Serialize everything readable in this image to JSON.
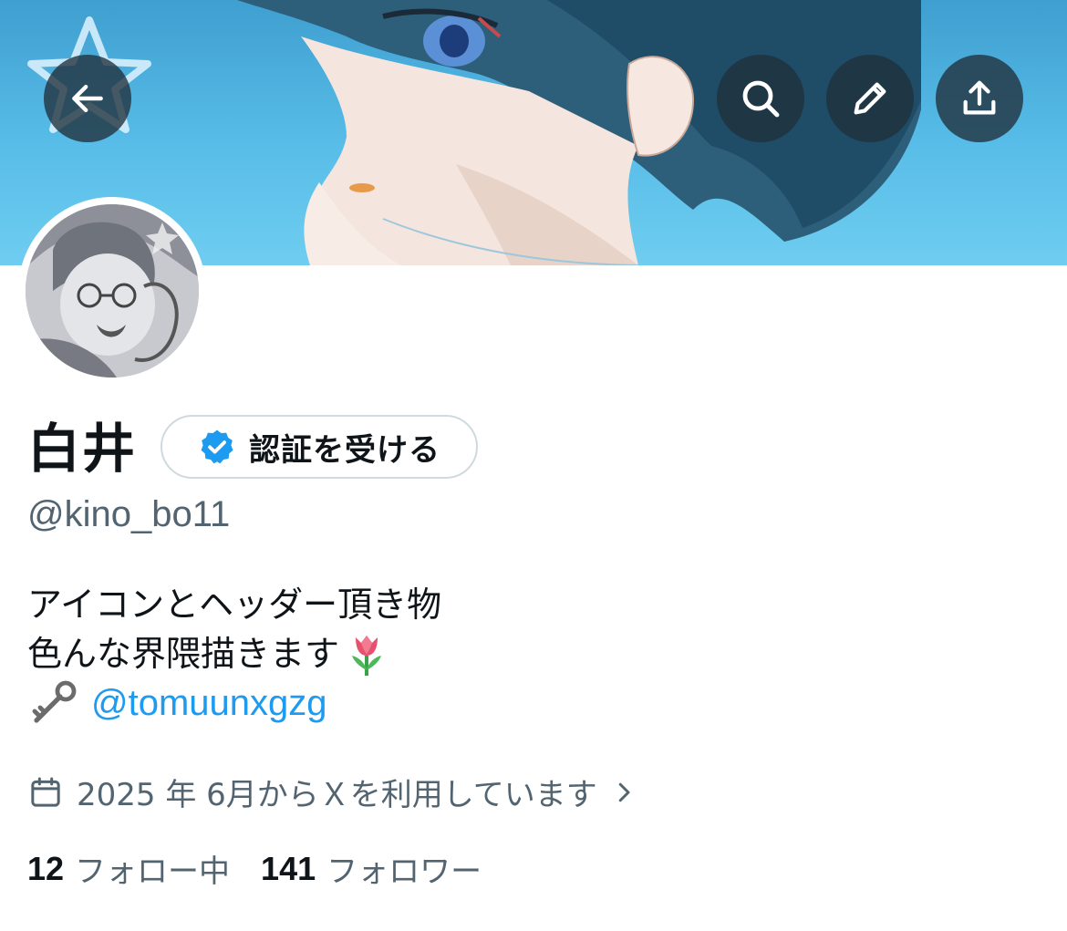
{
  "header": {
    "back_icon": "arrow-left-icon",
    "search_icon": "search-icon",
    "edit_icon": "pencil-icon",
    "share_icon": "share-icon"
  },
  "profile": {
    "display_name": "白井",
    "verify_button_label": "認証を受ける",
    "handle": "@kino_bo11",
    "bio": {
      "line1": "アイコンとヘッダー頂き物",
      "line2": "色んな界隈描きます",
      "line2_emoji": "🌷",
      "line3_emoji": "🗝",
      "mention": "@tomuunxgzg"
    },
    "joined": "2025 年 6月からＸを利用しています",
    "following_count": "12",
    "following_label": "フォロー中",
    "followers_count": "141",
    "followers_label": "フォロワー"
  },
  "colors": {
    "accent": "#1d9bf0",
    "secondary_text": "#536471",
    "primary_text": "#0f1419",
    "verify_badge": "#1d9bf0"
  }
}
